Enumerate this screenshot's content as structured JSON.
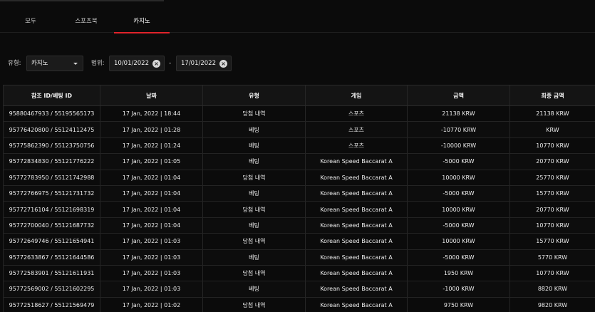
{
  "tabs": [
    {
      "label": "모두",
      "active": false
    },
    {
      "label": "스포츠북",
      "active": false
    },
    {
      "label": "카지노",
      "active": true
    }
  ],
  "filters": {
    "type_label": "유형:",
    "type_value": "카지노",
    "range_label": "범위:",
    "date_from": "10/01/2022",
    "date_to": "17/01/2022",
    "separator": "-"
  },
  "table": {
    "headers": [
      "참조 ID/베팅 ID",
      "날짜",
      "유형",
      "게임",
      "금액",
      "최종 금액"
    ],
    "rows": [
      [
        "95880467933 / 55195565173",
        "17 Jan, 2022 | 18:44",
        "당첨 내역",
        "스포츠",
        "21138 KRW",
        "21138 KRW"
      ],
      [
        "95776420800 / 55124112475",
        "17 Jan, 2022 | 01:28",
        "베팅",
        "스포츠",
        "-10770 KRW",
        "KRW"
      ],
      [
        "95775862390 / 55123750756",
        "17 Jan, 2022 | 01:24",
        "베팅",
        "스포츠",
        "-10000 KRW",
        "10770 KRW"
      ],
      [
        "95772834830 / 55121776222",
        "17 Jan, 2022 | 01:05",
        "베팅",
        "Korean Speed Baccarat A",
        "-5000 KRW",
        "20770 KRW"
      ],
      [
        "95772783950 / 55121742988",
        "17 Jan, 2022 | 01:04",
        "당첨 내역",
        "Korean Speed Baccarat A",
        "10000 KRW",
        "25770 KRW"
      ],
      [
        "95772766975 / 55121731732",
        "17 Jan, 2022 | 01:04",
        "베팅",
        "Korean Speed Baccarat A",
        "-5000 KRW",
        "15770 KRW"
      ],
      [
        "95772716104 / 55121698319",
        "17 Jan, 2022 | 01:04",
        "당첨 내역",
        "Korean Speed Baccarat A",
        "10000 KRW",
        "20770 KRW"
      ],
      [
        "95772700040 / 55121687732",
        "17 Jan, 2022 | 01:04",
        "베팅",
        "Korean Speed Baccarat A",
        "-5000 KRW",
        "10770 KRW"
      ],
      [
        "95772649746 / 55121654941",
        "17 Jan, 2022 | 01:03",
        "당첨 내역",
        "Korean Speed Baccarat A",
        "10000 KRW",
        "15770 KRW"
      ],
      [
        "95772633867 / 55121644586",
        "17 Jan, 2022 | 01:03",
        "베팅",
        "Korean Speed Baccarat A",
        "-5000 KRW",
        "5770 KRW"
      ],
      [
        "95772583901 / 55121611931",
        "17 Jan, 2022 | 01:03",
        "당첨 내역",
        "Korean Speed Baccarat A",
        "1950 KRW",
        "10770 KRW"
      ],
      [
        "95772569002 / 55121602295",
        "17 Jan, 2022 | 01:03",
        "베팅",
        "Korean Speed Baccarat A",
        "-1000 KRW",
        "8820 KRW"
      ],
      [
        "95772518627 / 55121569479",
        "17 Jan, 2022 | 01:02",
        "당첨 내역",
        "Korean Speed Baccarat A",
        "9750 KRW",
        "9820 KRW"
      ]
    ]
  },
  "colors": {
    "accent": "#e0232a",
    "background": "#0b0b0b"
  }
}
